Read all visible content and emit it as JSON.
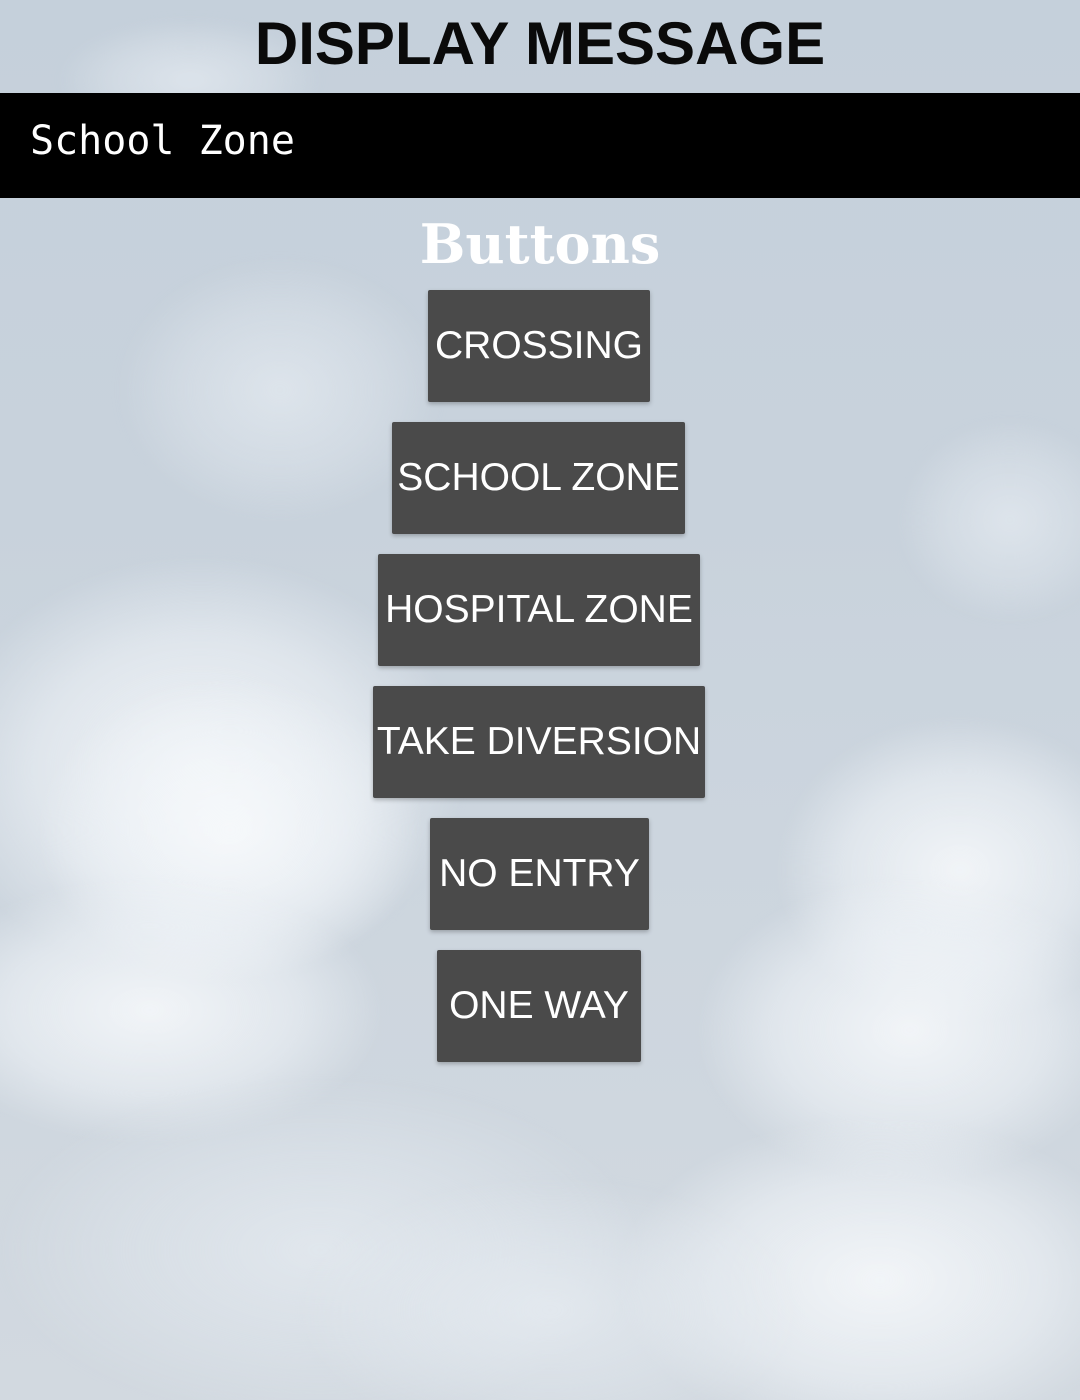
{
  "header": {
    "title": "DISPLAY MESSAGE"
  },
  "display": {
    "message": "School Zone"
  },
  "buttons_section": {
    "heading": "Buttons",
    "items": [
      {
        "label": "CROSSING"
      },
      {
        "label": "SCHOOL ZONE"
      },
      {
        "label": "HOSPITAL ZONE"
      },
      {
        "label": "TAKE DIVERSION"
      },
      {
        "label": "NO ENTRY"
      },
      {
        "label": "ONE WAY"
      }
    ]
  },
  "colors": {
    "button_background": "#4a4a4a",
    "display_background": "#000000",
    "display_text": "#ffffff",
    "heading_text": "#ffffff",
    "title_text": "#0a0a0a"
  }
}
